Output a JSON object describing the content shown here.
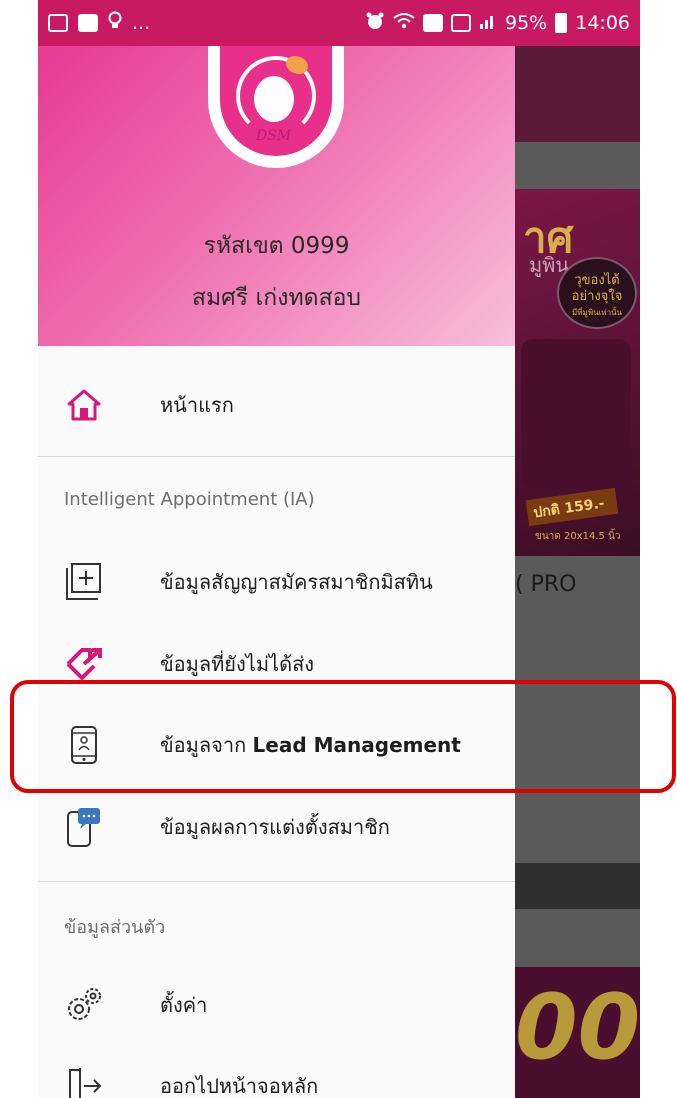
{
  "status_bar": {
    "left_overflow": "...",
    "battery": "95%",
    "time": "14:06"
  },
  "drawer": {
    "logo_text": "DSM",
    "header": {
      "code_line": "รหัสเขต 0999",
      "name_line": "สมศรี เก่งทดสอบ"
    },
    "home": {
      "label": "หน้าแรก"
    },
    "section_ia": "Intelligent Appointment (IA)",
    "ia_items": [
      {
        "label": "ข้อมูลสัญญาสมัครสมาชิกมิสทิน",
        "icon": "add-box-icon"
      },
      {
        "label": "ข้อมูลที่ยังไม่ได้ส่ง",
        "icon": "send-pending-icon"
      },
      {
        "label_prefix": "ข้อมูลจาก ",
        "label_bold": "Lead Management",
        "icon": "phone-lead-icon"
      },
      {
        "label": "ข้อมูลผลการแต่งตั้งสมาชิก",
        "icon": "chat-phone-icon"
      }
    ],
    "section_personal": "ข้อมูลส่วนตัว",
    "personal_items": [
      {
        "label": "ตั้งค่า",
        "icon": "settings-icon"
      },
      {
        "label": "ออกไปหน้าจอหลัก",
        "icon": "logout-icon"
      }
    ]
  },
  "background_app": {
    "banner_title": "าศ",
    "banner_sub": "มูพิน",
    "bubble_line1": "วุของได้",
    "bubble_line2": "อย่างจุใจ",
    "bubble_line3": "มีที่มูพินเท่านั้น",
    "price": "ปกติ 159.-",
    "size": "ขนาด 20x14.5 นิ้ว",
    "product_text": "( PRO",
    "bottom_number": "00"
  },
  "colors": {
    "status_bar": "#c71a63",
    "brand_pink": "#e8308a",
    "highlight_red": "#e00000"
  }
}
